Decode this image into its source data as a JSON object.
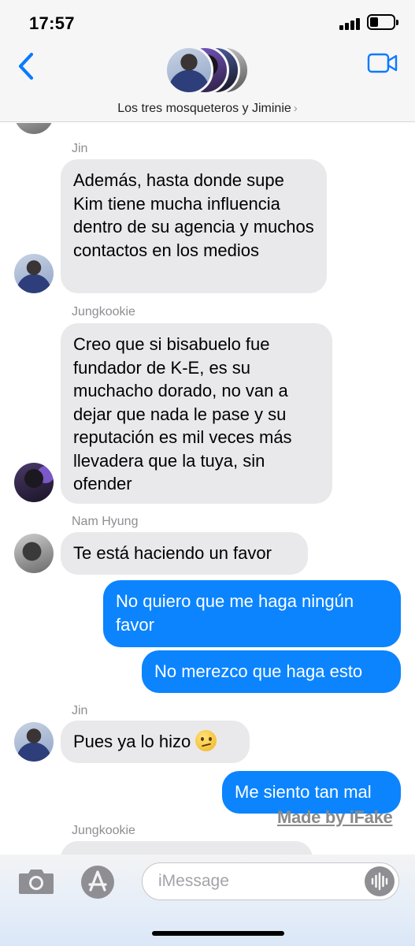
{
  "status_bar": {
    "time": "17:57"
  },
  "header": {
    "group_name": "Los tres mosqueteros y Jiminie",
    "chevron": "›"
  },
  "messages": [
    {
      "sender": "Jin",
      "text": "Además, hasta donde supe Kim tiene mucha influencia dentro de su agencia y muchos contactos en los medios"
    },
    {
      "sender": "Jungkookie",
      "text": "Creo que si bisabuelo fue fundador de K-E, es su muchacho dorado, no van a dejar que nada le pase y su reputación es mil veces más llevadera que la tuya, sin ofender"
    },
    {
      "sender": "Nam Hyung",
      "text": "Te está haciendo un favor"
    },
    {
      "sender": "",
      "text": "No quiero que me haga ningún favor"
    },
    {
      "sender": "",
      "text": "No merezco que haga esto"
    },
    {
      "sender": "Jin",
      "text": "Pues ya lo hizo"
    },
    {
      "sender": "",
      "text": "Me siento tan mal"
    },
    {
      "sender": "Jungkookie",
      "text": ""
    }
  ],
  "watermark": "Made by iFake",
  "input": {
    "placeholder": "iMessage"
  },
  "icons": {
    "back": "chevron-left-icon",
    "video": "video-camera-icon",
    "camera": "camera-icon",
    "apps": "app-store-icon",
    "audio": "waveform-icon",
    "emoji": "confused-face-emoji"
  },
  "colors": {
    "outgoing_bubble": "#0b84fe",
    "incoming_bubble": "#e9e9eb",
    "accent": "#0a7aff",
    "sender_name": "#8e8e93"
  }
}
